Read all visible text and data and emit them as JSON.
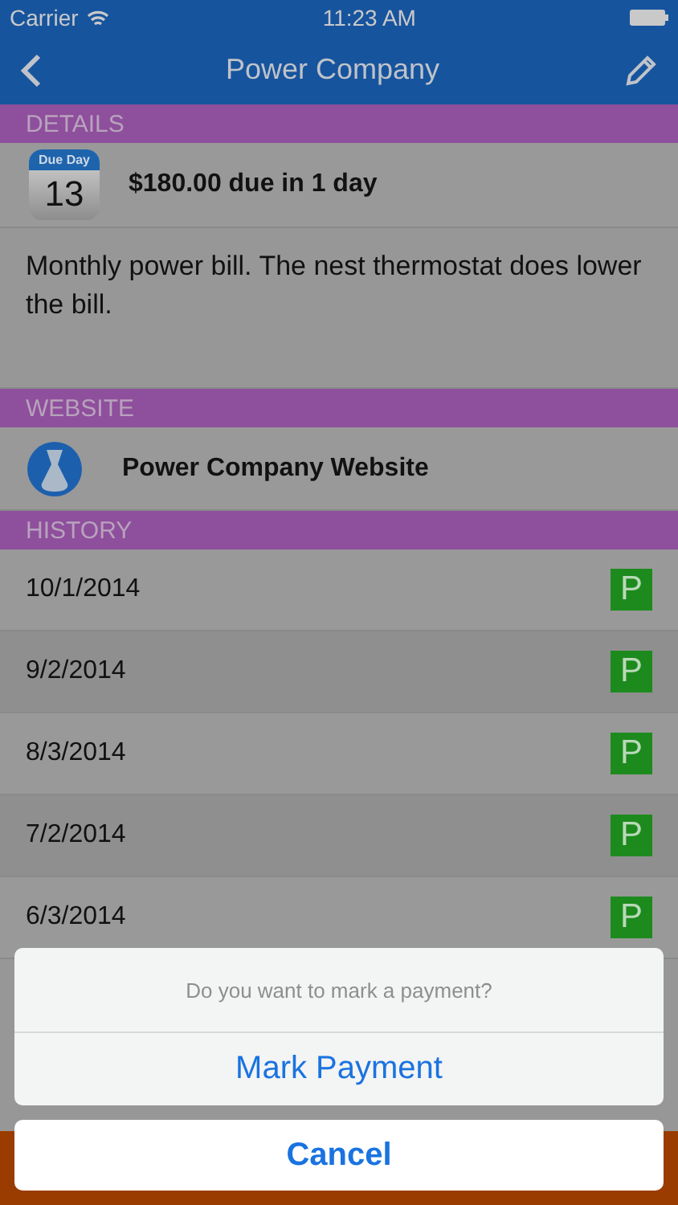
{
  "status_bar": {
    "carrier": "Carrier",
    "time": "11:23 AM"
  },
  "nav": {
    "title": "Power Company"
  },
  "details": {
    "header": "DETAILS",
    "calendar_label": "Due Day",
    "calendar_day": "13",
    "amount": "$180.00 due in 1 day",
    "note": "Monthly power bill. The nest thermostat does lower the bill."
  },
  "website": {
    "header": "WEBSITE",
    "link": "Power Company Website"
  },
  "history": {
    "header": "HISTORY",
    "rows": [
      {
        "date": "10/1/2014",
        "badge": "P"
      },
      {
        "date": "9/2/2014",
        "badge": "P"
      },
      {
        "date": "8/3/2014",
        "badge": "P"
      },
      {
        "date": "7/2/2014",
        "badge": "P"
      },
      {
        "date": "6/3/2014",
        "badge": "P"
      }
    ]
  },
  "action_sheet": {
    "message": "Do you want to mark a payment?",
    "action": "Mark Payment",
    "cancel": "Cancel"
  }
}
